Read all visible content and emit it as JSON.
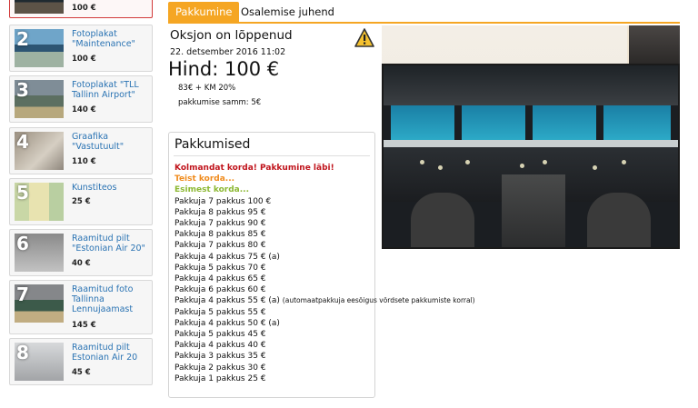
{
  "sidebar": {
    "lots": [
      {
        "number": "",
        "title": "",
        "price": "100 €"
      },
      {
        "number": "2",
        "title": "Fotoplakat \"Maintenance\"",
        "price": "100 €"
      },
      {
        "number": "3",
        "title": "Fotoplakat \"TLL Tallinn Airport\"",
        "price": "140 €"
      },
      {
        "number": "4",
        "title": "Graafika \"Vastutuult\"",
        "price": "110 €"
      },
      {
        "number": "5",
        "title": "Kunstiteos",
        "price": "25 €"
      },
      {
        "number": "6",
        "title": "Raamitud pilt \"Estonian Air 20\"",
        "price": "40 €"
      },
      {
        "number": "7",
        "title": "Raamitud foto Tallinna Lennujaamast",
        "price": "145 €"
      },
      {
        "number": "8",
        "title": "Raamitud pilt Estonian Air 20",
        "price": "45 €"
      }
    ]
  },
  "tabs": {
    "bidding": "Pakkumine",
    "guide": "Osalemise juhend"
  },
  "auction": {
    "status": "Oksjon on lõppenud",
    "datetime": "22. detsember 2016 11:02",
    "price": "Hind: 100 €",
    "net": "83€ + KM 20%",
    "step": "pakkumise samm: 5€"
  },
  "bids": {
    "title": "Pakkumised",
    "calls": [
      "Kolmandat korda! Pakkumine läbi!",
      "Teist korda...",
      "Esimest korda..."
    ],
    "lines": [
      "Pakkuja 7 pakkus 100 €",
      "Pakkuja 8 pakkus 95 €",
      "Pakkuja 7 pakkus 90 €",
      "Pakkuja 8 pakkus 85 €",
      "Pakkuja 7 pakkus 80 €",
      "Pakkuja 4 pakkus 75 € (a)",
      "Pakkuja 5 pakkus 70 €",
      "Pakkuja 4 pakkus 65 €",
      "Pakkuja 6 pakkus 60 €",
      "Pakkuja 4 pakkus 55 € (a)",
      "Pakkuja 5 pakkus 55 €",
      "Pakkuja 4 pakkus 50 € (a)",
      "Pakkuja 5 pakkus 45 €",
      "Pakkuja 4 pakkus 40 €",
      "Pakkuja 3 pakkus 35 €",
      "Pakkuja 2 pakkus 30 €",
      "Pakkuja 1 pakkus 25 €"
    ],
    "note": "(automaatpakkuja eesõigus võrdsete pakkumiste korral)"
  },
  "colors": {
    "accent": "#f5a623",
    "link": "#2a73b3",
    "sold": "#c0141c",
    "second": "#f08b1c",
    "first": "#8cb832"
  }
}
